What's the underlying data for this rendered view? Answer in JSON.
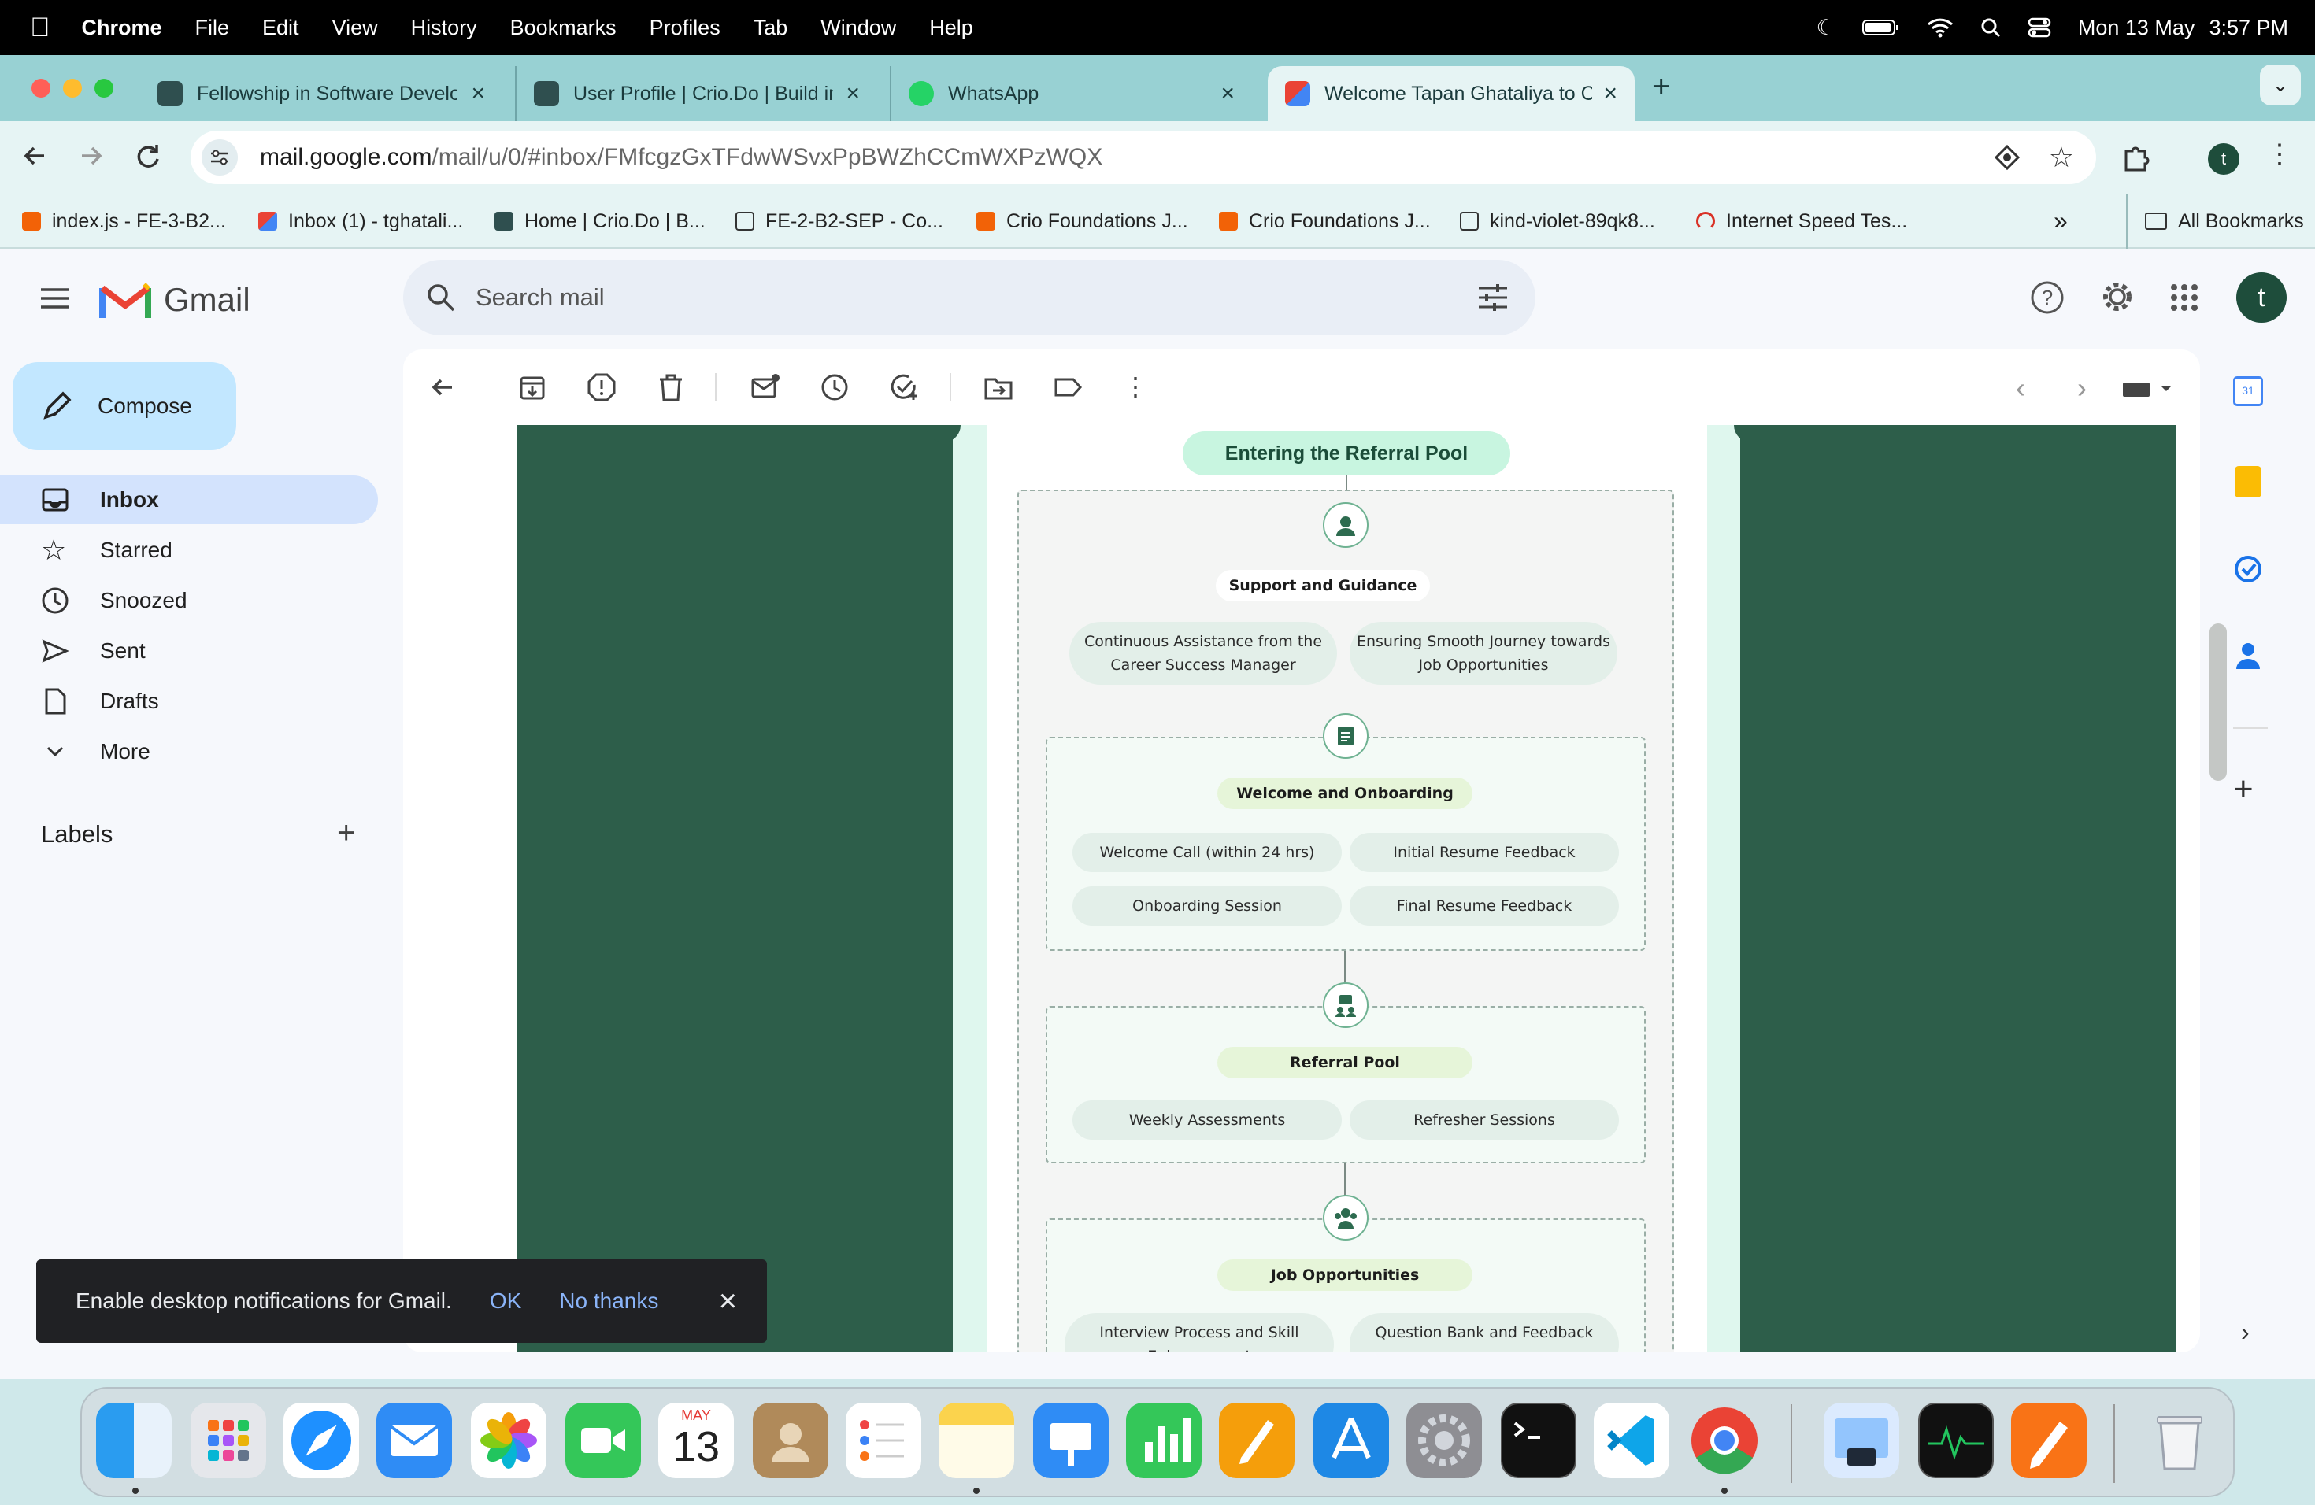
{
  "menubar": {
    "app": "Chrome",
    "items": [
      "File",
      "Edit",
      "View",
      "History",
      "Bookmarks",
      "Profiles",
      "Tab",
      "Window",
      "Help"
    ],
    "date": "Mon 13 May",
    "time": "3:57 PM"
  },
  "tabs": [
    {
      "title": "Fellowship in Software Develo",
      "icon": "crio-icon"
    },
    {
      "title": "User Profile | Crio.Do | Build in",
      "icon": "crio-icon"
    },
    {
      "title": "WhatsApp",
      "icon": "whatsapp-icon"
    },
    {
      "title": "Welcome Tapan Ghataliya to C",
      "icon": "gmail-icon",
      "active": true
    }
  ],
  "omnibox": {
    "domain": "mail.google.com",
    "path": "/mail/u/0/#inbox/FMfcgzGxTFdwWSvxPpBWZhCCmWXPzWQX"
  },
  "profile_initial": "t",
  "bookmarks": [
    {
      "label": "index.js - FE-3-B2...",
      "icon": "replit-icon"
    },
    {
      "label": "Inbox (1) - tghatali...",
      "icon": "gmail-icon"
    },
    {
      "label": "Home | Crio.Do | B...",
      "icon": "crio-icon"
    },
    {
      "label": "FE-2-B2-SEP - Co...",
      "icon": "page-icon"
    },
    {
      "label": "Crio Foundations J...",
      "icon": "replit-icon"
    },
    {
      "label": "Crio Foundations J...",
      "icon": "replit-icon"
    },
    {
      "label": "kind-violet-89qk8...",
      "icon": "page-icon"
    },
    {
      "label": "Internet Speed Tes...",
      "icon": "speed-icon"
    }
  ],
  "all_bookmarks": "All Bookmarks",
  "gmail": {
    "logo_text": "Gmail",
    "search_placeholder": "Search mail",
    "compose": "Compose",
    "nav": [
      {
        "label": "Inbox",
        "icon": "inbox-icon",
        "active": true
      },
      {
        "label": "Starred",
        "icon": "star-icon"
      },
      {
        "label": "Snoozed",
        "icon": "clock-icon"
      },
      {
        "label": "Sent",
        "icon": "send-icon"
      },
      {
        "label": "Drafts",
        "icon": "draft-icon"
      },
      {
        "label": "More",
        "icon": "chevron-down-icon"
      }
    ],
    "labels_heading": "Labels",
    "account_initial": "t"
  },
  "email": {
    "title": "Entering the Referral Pool",
    "sections": [
      {
        "heading": "Support and Guidance",
        "items": [
          "Continuous Assistance from the Career Success Manager",
          "Ensuring Smooth Journey towards Job Opportunities"
        ]
      },
      {
        "heading": "Welcome and Onboarding",
        "items": [
          "Welcome Call (within 24 hrs)",
          "Initial Resume Feedback",
          "Onboarding Session",
          "Final Resume Feedback"
        ]
      },
      {
        "heading": "Referral Pool",
        "items": [
          "Weekly Assessments",
          "Refresher Sessions"
        ]
      },
      {
        "heading": "Job Opportunities",
        "items": [
          "Interview Process and Skill Enhancement",
          "Question Bank and Feedback"
        ]
      }
    ]
  },
  "snackbar": {
    "message": "Enable desktop notifications for Gmail.",
    "ok": "OK",
    "no_thanks": "No thanks"
  },
  "dock": {
    "calendar_month": "MAY",
    "calendar_day": "13",
    "apps": [
      "finder-icon",
      "launchpad-icon",
      "safari-icon",
      "mail-icon",
      "photos-icon",
      "facetime-icon",
      "calendar-icon",
      "contacts-icon",
      "reminders-icon",
      "notes-icon",
      "keynote-icon",
      "numbers-icon",
      "pages-icon",
      "app-store-icon",
      "system-settings-icon",
      "terminal-icon",
      "vscode-icon",
      "chrome-icon",
      "preview-icon",
      "activity-monitor-icon",
      "pen-icon",
      "trash-icon"
    ]
  },
  "colors": {
    "email_bg": "#2d5e4a",
    "accent_mint": "#c8f5e0",
    "gmail_selected": "#d3e3fd",
    "tab_strip": "#98d1d3"
  }
}
